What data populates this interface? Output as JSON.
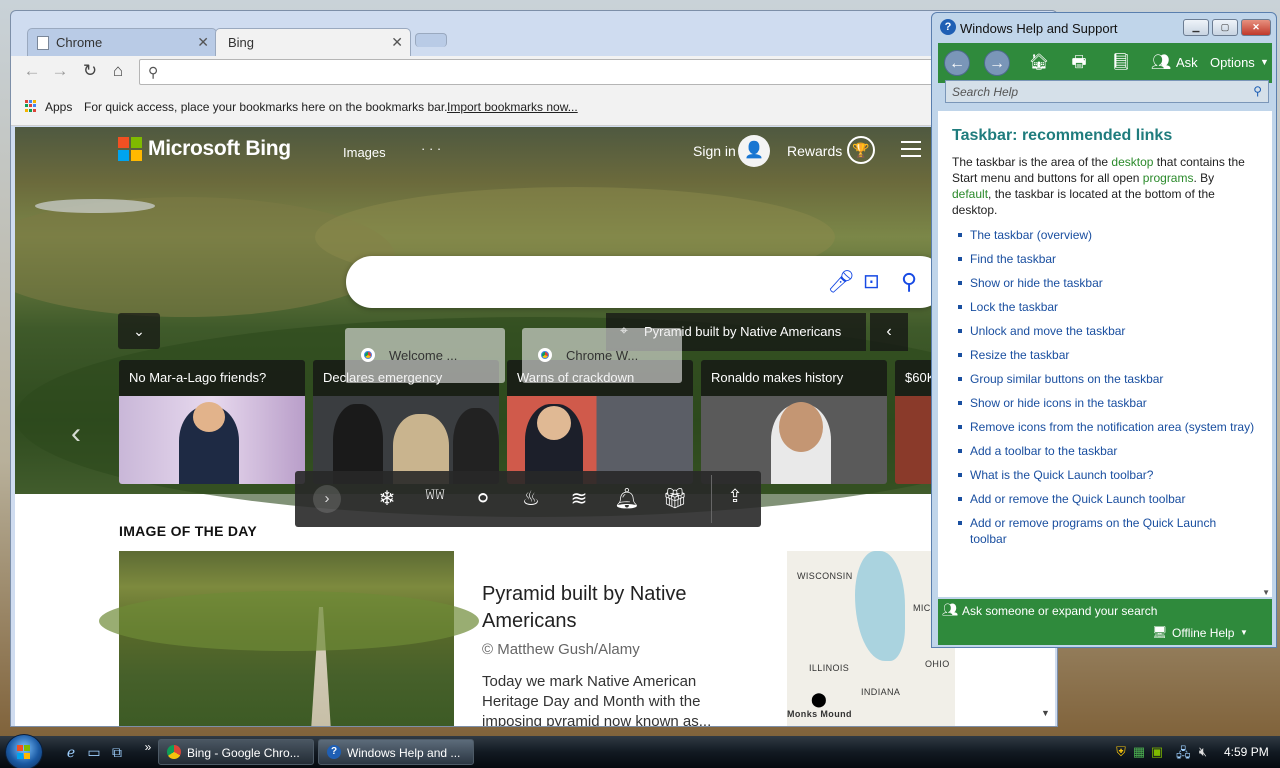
{
  "chrome": {
    "tabs": [
      {
        "label": "Chrome"
      },
      {
        "label": "Bing"
      }
    ],
    "tab_close_glyph": "✕",
    "bookmarks_bar": {
      "apps_label": "Apps",
      "message": "For quick access, place your bookmarks here on the bookmarks bar.",
      "import_link": "Import bookmarks now..."
    }
  },
  "bing": {
    "logo_text": "Microsoft Bing",
    "nav_images": "Images",
    "nav_more": "· · ·",
    "signin": "Sign in",
    "rewards": "Rewards",
    "image_of_day_pill": "Pyramid built by Native Americans",
    "news_cards": [
      {
        "title": "No Mar-a-Lago friends?"
      },
      {
        "title": "Declares emergency"
      },
      {
        "title": "Warns of crackdown"
      },
      {
        "title": "Ronaldo makes history"
      },
      {
        "title": "$60K"
      }
    ],
    "chrome_popups": [
      {
        "label": "Welcome ..."
      },
      {
        "label": "Chrome W..."
      }
    ],
    "iotd": {
      "heading": "IMAGE OF THE DAY",
      "title": "Pyramid built by Native Americans",
      "credit": "© Matthew Gush/Alamy",
      "description": "Today we mark Native American Heritage Day and Month with the imposing pyramid now known as..."
    },
    "map_labels": {
      "wisconsin": "WISCONSIN",
      "michigan": "MICHIGA",
      "illinois": "ILLINOIS",
      "ohio": "OHIO",
      "indiana": "INDIANA",
      "monks_mound": "Monks Mound"
    }
  },
  "help": {
    "window_title": "Windows Help and Support",
    "toolbar": {
      "ask": "Ask",
      "options": "Options"
    },
    "search_placeholder": "Search Help",
    "heading": "Taskbar: recommended links",
    "intro": {
      "part1": "The taskbar is the area of the ",
      "link1": "desktop",
      "part2": " that contains the Start menu and buttons for all open ",
      "link2": "programs",
      "part3": ". By ",
      "link3": "default",
      "part4": ", the taskbar is located at the bottom of the desktop."
    },
    "links": [
      "The taskbar (overview)",
      "Find the taskbar",
      "Show or hide the taskbar",
      "Lock the taskbar",
      "Unlock and move the taskbar",
      "Resize the taskbar",
      "Group similar buttons on the taskbar",
      "Show or hide icons in the taskbar",
      "Remove icons from the notification area (system tray)",
      "Add a toolbar to the taskbar",
      "What is the Quick Launch toolbar?",
      "Add or remove the Quick Launch toolbar",
      "Add or remove programs on the Quick Launch toolbar"
    ],
    "bottom": {
      "ask_expand": "Ask someone or expand your search",
      "offline": "Offline Help"
    }
  },
  "taskbar": {
    "tasks": [
      {
        "label": "Bing - Google Chro..."
      },
      {
        "label": "Windows Help and ..."
      }
    ],
    "more_glyph": "»",
    "time": "4:59 PM"
  },
  "colors": {
    "help_green": "#2f8a3c",
    "help_link": "#1a4fa0",
    "help_heading": "#1f7c7d",
    "bing_blue": "#174ae4"
  }
}
